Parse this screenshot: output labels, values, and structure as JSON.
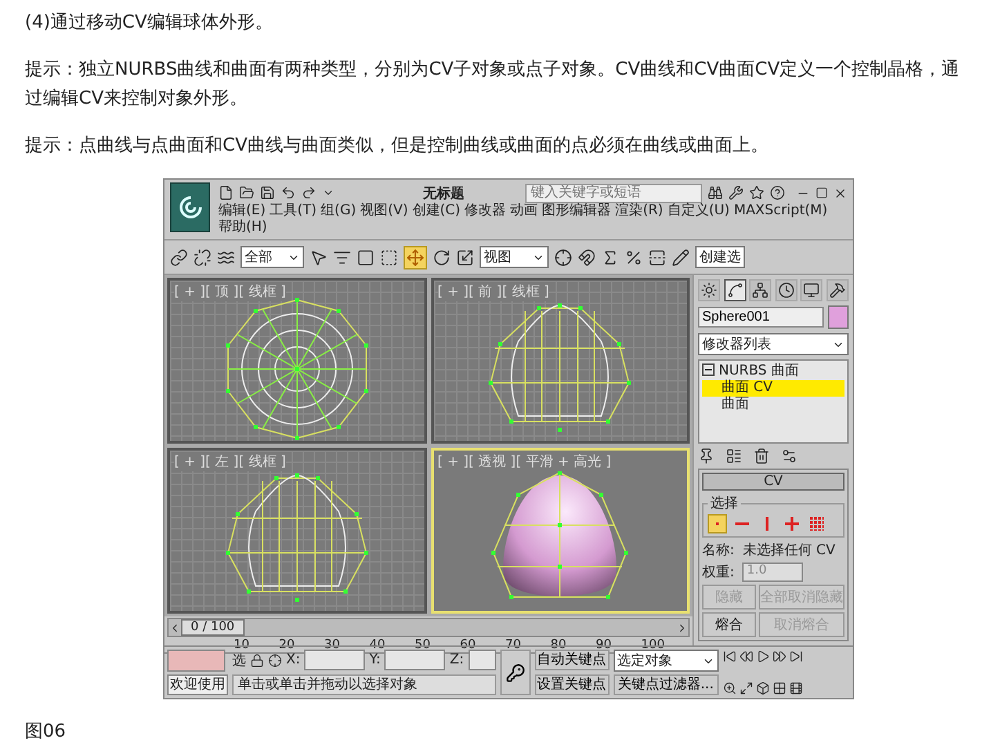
{
  "article": {
    "heading": "(4)通过移动CV编辑球体外形。",
    "tips": [
      "提示：独立NURBS曲线和曲面有两种类型，分别为CV子对象或点子对象。CV曲线和CV曲面CV定义一个控制晶格，通过编辑CV来控制对象外形。",
      "提示：点曲线与点曲面和CV曲线与曲面类似，但是控制曲线或曲面的点必须在曲线或曲面上。"
    ],
    "caption": "图06"
  },
  "app": {
    "title": "无标题",
    "search": {
      "placeholder": "键入关键字或短语"
    },
    "menus": [
      "编辑(E)",
      "工具(T)",
      "组(G)",
      "视图(V)",
      "创建(C)",
      "修改器",
      "动画",
      "图形编辑器",
      "渲染(R)",
      "自定义(U)",
      "MAXScript(M)",
      "帮助(H)"
    ],
    "toolbar": {
      "selection_filter": "全部",
      "coordinate_system": "视图",
      "named_selection": "创建选"
    },
    "viewports": [
      {
        "label": "[ + ][ 顶 ][ 线框 ]",
        "kind": "top",
        "active": false
      },
      {
        "label": "[ + ][ 前 ][ 线框 ]",
        "kind": "front",
        "active": false
      },
      {
        "label": "[ + ][ 左 ][ 线框 ]",
        "kind": "left",
        "active": false
      },
      {
        "label": "[ + ][ 透视 ][ 平滑 + 高光 ]",
        "kind": "perspective",
        "active": true
      }
    ],
    "command_panel": {
      "tabs": [
        {
          "kind": "create",
          "selected": false
        },
        {
          "kind": "modify",
          "selected": true
        },
        {
          "kind": "hierarchy",
          "selected": false
        },
        {
          "kind": "motion",
          "selected": false
        },
        {
          "kind": "display",
          "selected": false
        },
        {
          "kind": "utilities",
          "selected": false
        }
      ],
      "object_name": "Sphere001",
      "modifier_list": "修改器列表",
      "stack": [
        {
          "label": "NURBS 曲面",
          "expanded": true,
          "selected": false,
          "children": [
            {
              "label": "曲面 CV",
              "selected": true
            },
            {
              "label": "曲面",
              "selected": false
            }
          ]
        }
      ],
      "rollout": {
        "title": "CV",
        "group": "选择",
        "selection_levels": [
          {
            "kind": "single",
            "selected": true
          },
          {
            "kind": "row",
            "selected": false
          },
          {
            "kind": "column",
            "selected": false
          },
          {
            "kind": "cross",
            "selected": false
          },
          {
            "kind": "all",
            "selected": false
          }
        ],
        "name_label": "名称:",
        "name_value": "未选择任何 CV",
        "weight_label": "权重:",
        "weight": "1.0",
        "buttons": [
          {
            "label": "隐藏",
            "disabled": true
          },
          {
            "label": "全部取消隐藏",
            "disabled": true
          },
          {
            "label": "熔合",
            "disabled": false
          },
          {
            "label": "取消熔合",
            "disabled": true
          }
        ]
      }
    },
    "timeline": {
      "frame": "0 / 100",
      "level": 0,
      "ticks": [
        "10",
        "20",
        "30",
        "40",
        "50",
        "60",
        "70",
        "80",
        "90",
        "100"
      ]
    },
    "status": {
      "welcome": "欢迎使用",
      "selection_lock": "选",
      "x_label": "X:",
      "y_label": "Y:",
      "z_label": "Z:",
      "prompt": "单击或单击并拖动以选择对象",
      "auto_key": "自动关键点",
      "set_key": "设置关键点",
      "key_target": "选定对象",
      "key_filters": "关键点过滤器..."
    }
  }
}
